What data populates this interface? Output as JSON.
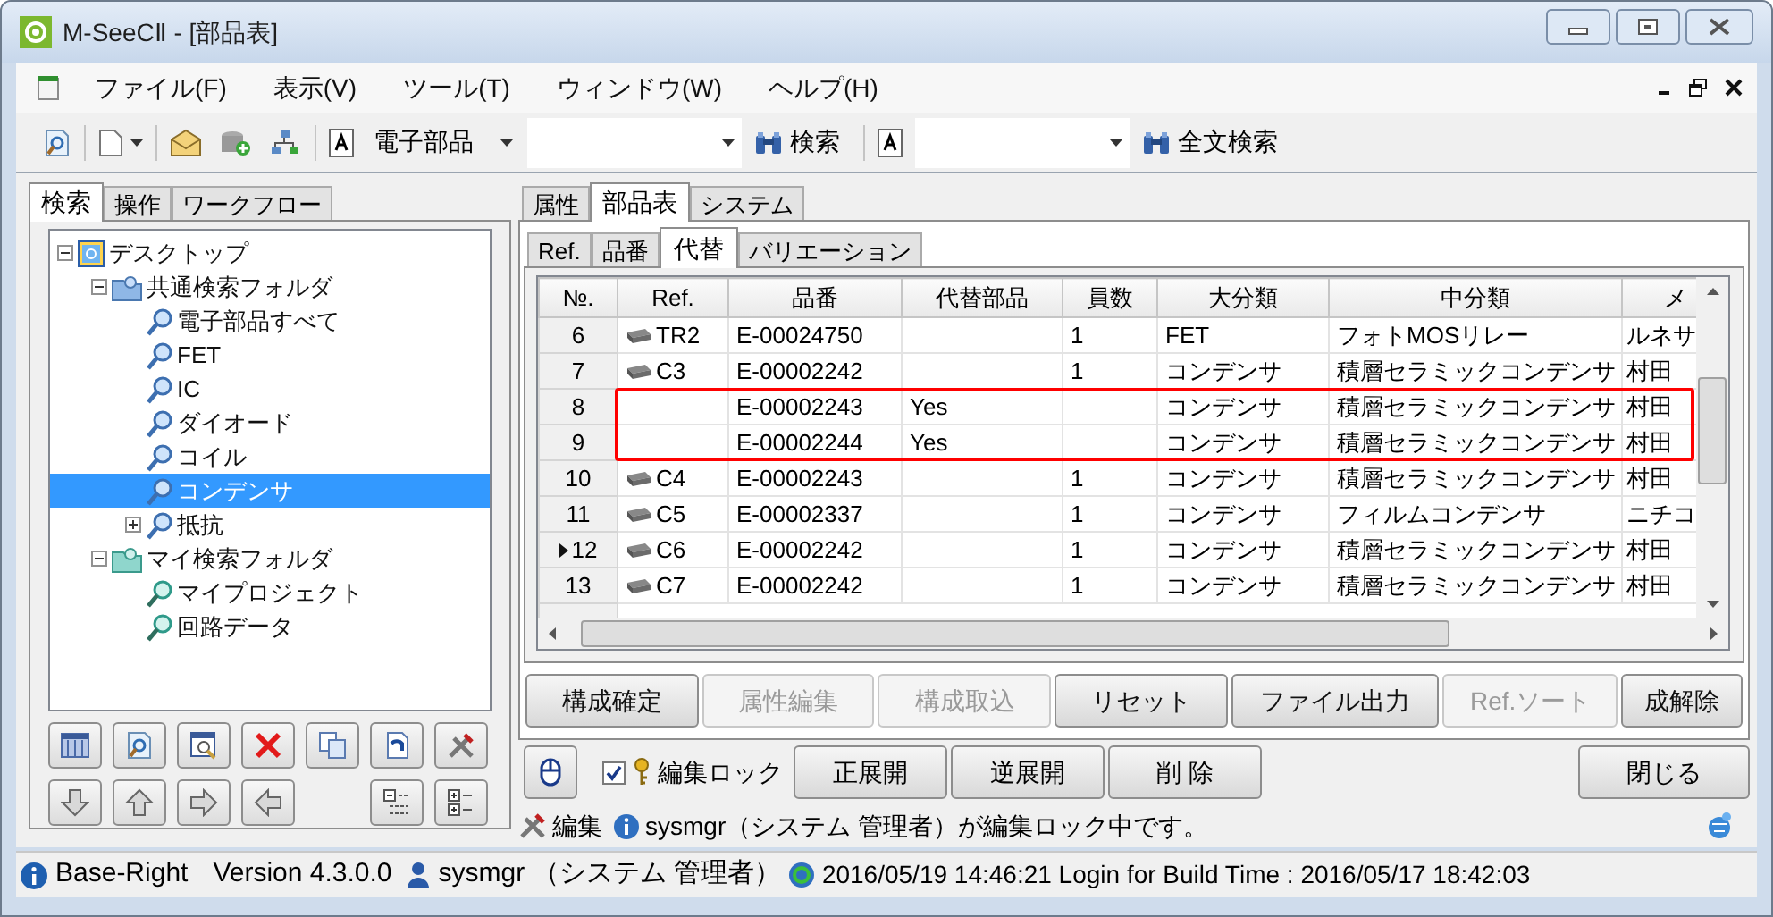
{
  "window": {
    "title": "M-SeeCⅡ - [部品表]"
  },
  "menu": [
    "ファイル(F)",
    "表示(V)",
    "ツール(T)",
    "ウィンドウ(W)",
    "ヘルプ(H)"
  ],
  "toolbar": {
    "category": "電子部品",
    "search_button": "検索",
    "fulltext_button": "全文検索"
  },
  "left_tabs": [
    {
      "label": "検索",
      "selected": true
    },
    {
      "label": "操作",
      "selected": false
    },
    {
      "label": "ワークフロー",
      "selected": false
    }
  ],
  "tree": [
    {
      "label": "デスクトップ",
      "kind": "desktop",
      "expanded": true,
      "selected": false,
      "children": [
        {
          "label": "共通検索フォルダ",
          "kind": "folder",
          "expanded": true,
          "selected": false,
          "children": [
            {
              "label": "電子部品すべて",
              "kind": "search",
              "selected": false
            },
            {
              "label": "FET",
              "kind": "search",
              "selected": false
            },
            {
              "label": "IC",
              "kind": "search",
              "selected": false
            },
            {
              "label": "ダイオード",
              "kind": "search",
              "selected": false
            },
            {
              "label": "コイル",
              "kind": "search",
              "selected": false
            },
            {
              "label": "コンデンサ",
              "kind": "search",
              "selected": true
            },
            {
              "label": "抵抗",
              "kind": "search",
              "expanded": false,
              "selected": false
            }
          ]
        },
        {
          "label": "マイ検索フォルダ",
          "kind": "my-folder",
          "expanded": true,
          "selected": false,
          "children": [
            {
              "label": "マイプロジェクト",
              "kind": "my-search",
              "selected": false
            },
            {
              "label": "回路データ",
              "kind": "my-search",
              "selected": false
            }
          ]
        }
      ]
    }
  ],
  "right_tabs": [
    {
      "label": "属性",
      "selected": false
    },
    {
      "label": "部品表",
      "selected": true
    },
    {
      "label": "システム",
      "selected": false
    }
  ],
  "sub_tabs": [
    {
      "label": "Ref.",
      "selected": false
    },
    {
      "label": "品番",
      "selected": false
    },
    {
      "label": "代替",
      "selected": true
    },
    {
      "label": "バリエーション",
      "selected": false
    }
  ],
  "table": {
    "columns": [
      "№.",
      "Ref.",
      "品番",
      "代替部品",
      "員数",
      "大分類",
      "中分類",
      "メ"
    ],
    "rows": [
      {
        "cells": [
          "6",
          "TR2",
          "E-00024750",
          "",
          "1",
          "FET",
          "フォトMOSリレー",
          "ルネサ"
        ],
        "current": false,
        "highlighted": false
      },
      {
        "cells": [
          "7",
          "C3",
          "E-00002242",
          "",
          "1",
          "コンデンサ",
          "積層セラミックコンデンサ",
          "村田"
        ],
        "current": false,
        "highlighted": false
      },
      {
        "cells": [
          "8",
          "",
          "E-00002243",
          "Yes",
          "",
          "コンデンサ",
          "積層セラミックコンデンサ",
          "村田"
        ],
        "current": false,
        "highlighted": true
      },
      {
        "cells": [
          "9",
          "",
          "E-00002244",
          "Yes",
          "",
          "コンデンサ",
          "積層セラミックコンデンサ",
          "村田"
        ],
        "current": false,
        "highlighted": true
      },
      {
        "cells": [
          "10",
          "C4",
          "E-00002243",
          "",
          "1",
          "コンデンサ",
          "積層セラミックコンデンサ",
          "村田"
        ],
        "current": false,
        "highlighted": false
      },
      {
        "cells": [
          "11",
          "C5",
          "E-00002337",
          "",
          "1",
          "コンデンサ",
          "フィルムコンデンサ",
          "ニチコ"
        ],
        "current": false,
        "highlighted": false
      },
      {
        "cells": [
          "12",
          "C6",
          "E-00002242",
          "",
          "1",
          "コンデンサ",
          "積層セラミックコンデンサ",
          "村田"
        ],
        "current": true,
        "highlighted": false
      },
      {
        "cells": [
          "13",
          "C7",
          "E-00002242",
          "",
          "1",
          "コンデンサ",
          "積層セラミックコンデンサ",
          "村田"
        ],
        "current": false,
        "highlighted": false
      }
    ]
  },
  "actions": [
    {
      "label": "構成確定",
      "disabled": false
    },
    {
      "label": "属性編集",
      "disabled": true
    },
    {
      "label": "構成取込",
      "disabled": true
    },
    {
      "label": "リセット",
      "disabled": false
    },
    {
      "label": "ファイル出力",
      "disabled": false
    },
    {
      "label": "Ref.ソート",
      "disabled": true
    },
    {
      "label": "成解除",
      "disabled": false
    }
  ],
  "lock": {
    "label": "編集ロック",
    "checked": true
  },
  "tree_buttons": [
    "正展開",
    "逆展開",
    "削 除"
  ],
  "close_button": "閉じる",
  "message": {
    "mode": "編集",
    "text": "sysmgr（システム 管理者）が編集ロック中です。"
  },
  "status": {
    "app": "Base-Right",
    "version": "Version 4.3.0.0",
    "user": "sysmgr （システム 管理者）",
    "time": "2016/05/19 14:46:21 Login for Build Time : 2016/05/17 18:42:03"
  }
}
